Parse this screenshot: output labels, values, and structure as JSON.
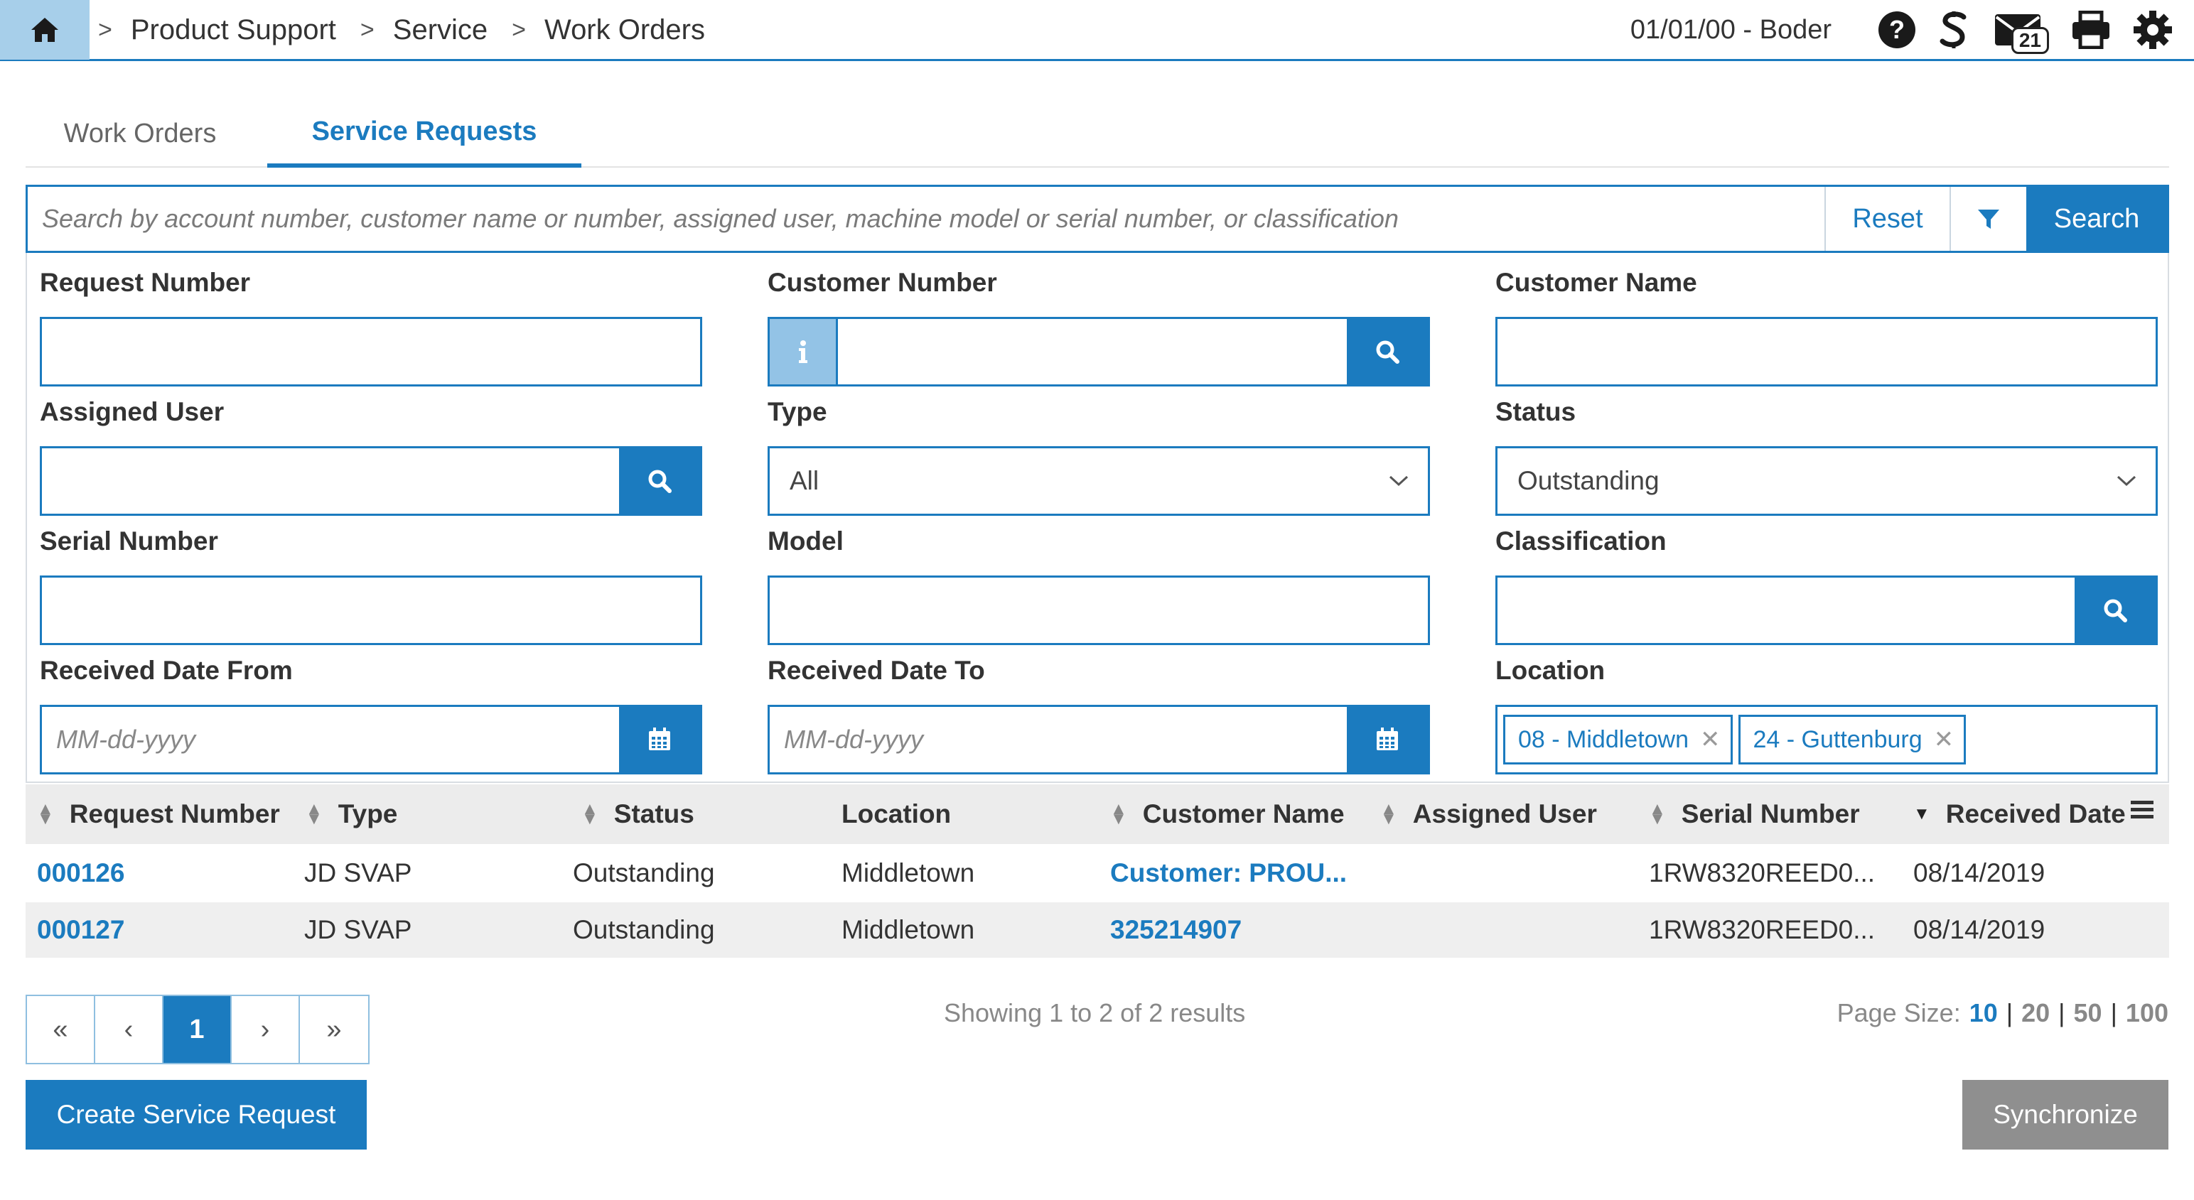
{
  "header": {
    "breadcrumbs": [
      "Product Support",
      "Service",
      "Work Orders"
    ],
    "separator": ">",
    "user_info": "01/01/00 - Boder",
    "mail_count": "21"
  },
  "tabs": [
    {
      "label": "Work Orders",
      "active": false
    },
    {
      "label": "Service Requests",
      "active": true
    }
  ],
  "search": {
    "placeholder": "Search by account number, customer name or number, assigned user, machine model or serial number, or classification",
    "value": "",
    "reset_label": "Reset",
    "search_label": "Search"
  },
  "filters": {
    "request_number": {
      "label": "Request Number",
      "value": ""
    },
    "customer_number": {
      "label": "Customer Number",
      "value": ""
    },
    "customer_name": {
      "label": "Customer Name",
      "value": ""
    },
    "assigned_user": {
      "label": "Assigned User",
      "value": ""
    },
    "type": {
      "label": "Type",
      "selected": "All"
    },
    "status": {
      "label": "Status",
      "selected": "Outstanding"
    },
    "serial_number": {
      "label": "Serial Number",
      "value": ""
    },
    "model": {
      "label": "Model",
      "value": ""
    },
    "classification": {
      "label": "Classification",
      "value": ""
    },
    "received_from": {
      "label": "Received Date From",
      "placeholder": "MM-dd-yyyy"
    },
    "received_to": {
      "label": "Received Date To",
      "placeholder": "MM-dd-yyyy"
    },
    "location": {
      "label": "Location",
      "chips": [
        "08 - Middletown",
        "24 - Guttenburg"
      ]
    }
  },
  "table": {
    "columns": [
      "Request Number",
      "Type",
      "Status",
      "Location",
      "Customer Name",
      "Assigned User",
      "Serial Number",
      "Received Date"
    ],
    "rows": [
      [
        "000126",
        "JD SVAP",
        "Outstanding",
        "Middletown",
        "Customer: PROU...",
        "",
        "1RW8320REED0...",
        "08/14/2019"
      ],
      [
        "000127",
        "JD SVAP",
        "Outstanding",
        "Middletown",
        "325214907",
        "",
        "1RW8320REED0...",
        "08/14/2019"
      ]
    ]
  },
  "pagination": {
    "first": "«",
    "prev": "‹",
    "current": "1",
    "next": "›",
    "last": "»",
    "showing_text": "Showing 1 to 2 of 2 results",
    "page_size_label": "Page Size:",
    "page_sizes": [
      "10",
      "20",
      "50",
      "100"
    ],
    "active_page_size": "10"
  },
  "actions": {
    "create_label": "Create Service Request",
    "sync_label": "Synchronize"
  },
  "colors": {
    "accent": "#1b7bbf",
    "home_bg": "#a7cfea",
    "sync_bg": "#8f8f8f"
  },
  "icons": [
    "home-icon",
    "help-icon",
    "s-logo-icon",
    "mail-icon",
    "print-icon",
    "gear-icon",
    "filter-icon",
    "search-icon",
    "info-icon",
    "calendar-icon",
    "chevron-down-icon",
    "close-icon",
    "sort-icon",
    "sort-desc-icon",
    "menu-icon"
  ]
}
